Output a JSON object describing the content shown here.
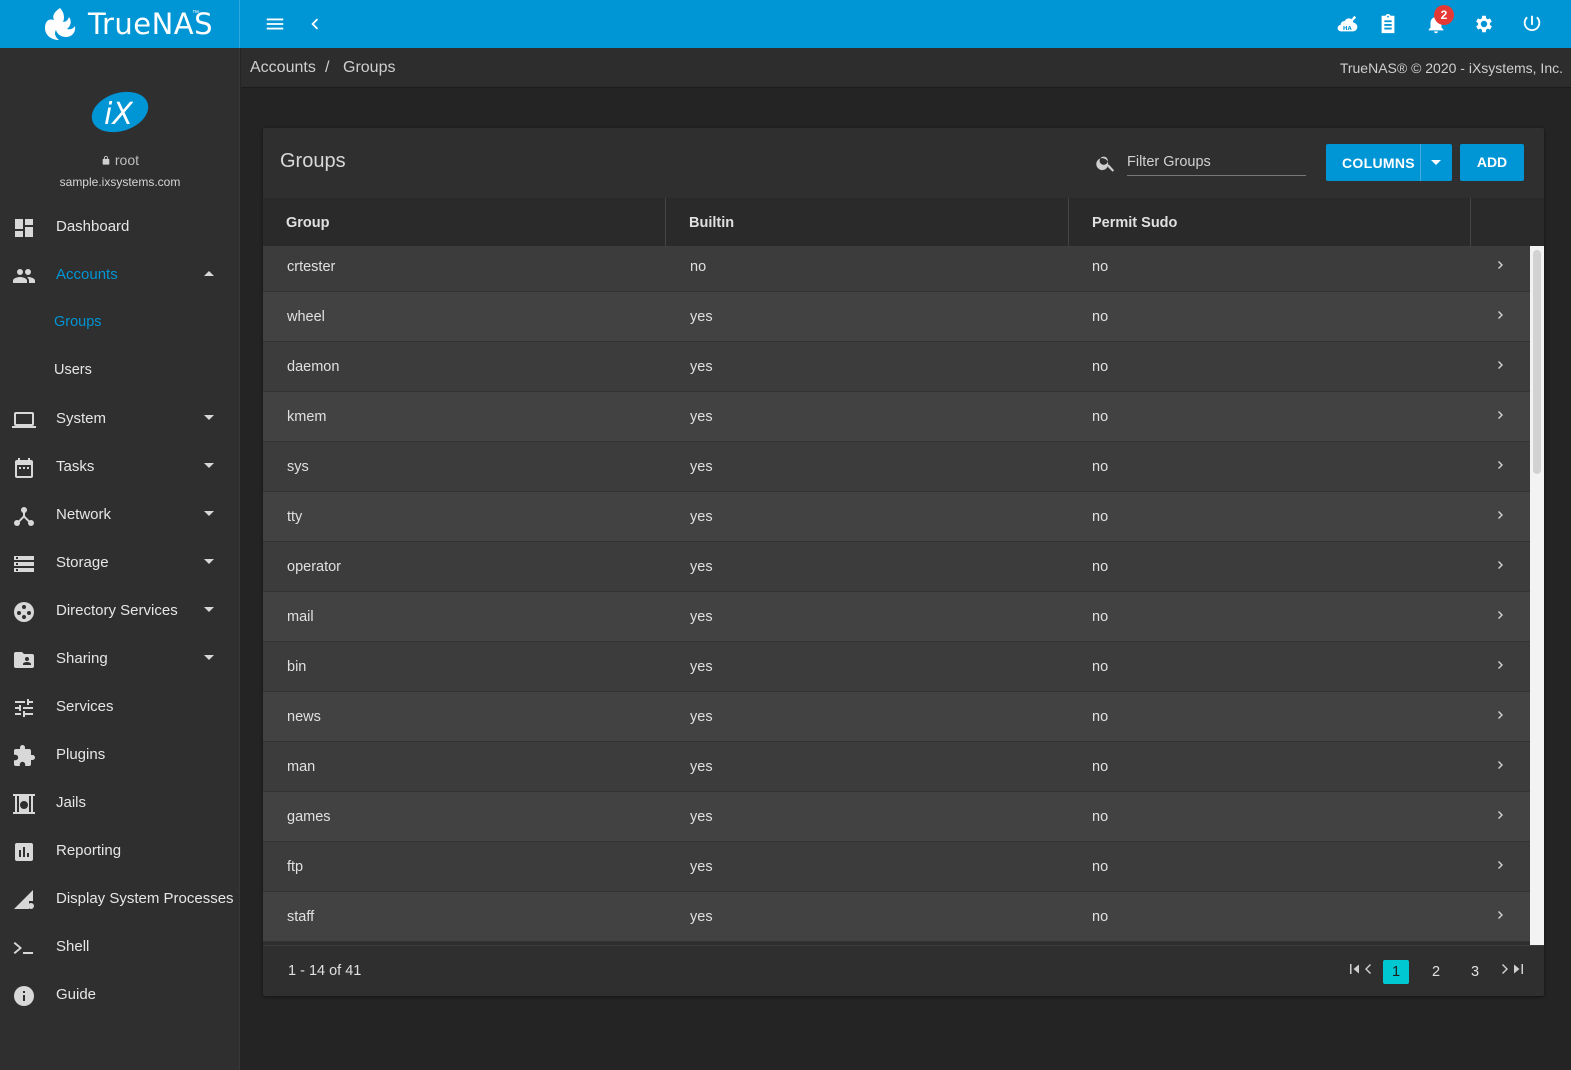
{
  "app": {
    "brand": "TrueNAS",
    "brand_tm": "™"
  },
  "topbar": {
    "menu_icon": "menu-icon",
    "back_icon": "chevron-left-icon",
    "ha_icon": "ha-status-icon",
    "tasks_icon": "clipboard-icon",
    "alerts_icon": "bell-icon",
    "alerts_count": "2",
    "settings_icon": "gear-icon",
    "power_icon": "power-icon"
  },
  "sidebar": {
    "logo": "iX",
    "user": "root",
    "hostname": "sample.ixsystems.com",
    "items": [
      {
        "label": "Dashboard",
        "icon": "dashboard-icon"
      },
      {
        "label": "Accounts",
        "icon": "people-icon"
      },
      {
        "label": "Groups"
      },
      {
        "label": "Users"
      },
      {
        "label": "System",
        "icon": "laptop-icon"
      },
      {
        "label": "Tasks",
        "icon": "calendar-icon"
      },
      {
        "label": "Network",
        "icon": "network-icon"
      },
      {
        "label": "Storage",
        "icon": "storage-icon"
      },
      {
        "label": "Directory Services",
        "icon": "directory-icon"
      },
      {
        "label": "Sharing",
        "icon": "folder-shared-icon"
      },
      {
        "label": "Services",
        "icon": "tune-icon"
      },
      {
        "label": "Plugins",
        "icon": "puzzle-icon"
      },
      {
        "label": "Jails",
        "icon": "jail-icon"
      },
      {
        "label": "Reporting",
        "icon": "bar-chart-icon"
      },
      {
        "label": "Display System Processes",
        "icon": "processes-icon"
      },
      {
        "label": "Shell",
        "icon": "terminal-icon"
      },
      {
        "label": "Guide",
        "icon": "info-icon"
      }
    ]
  },
  "breadcrumb": {
    "parent": "Accounts",
    "separator": "/",
    "current": "Groups"
  },
  "copyright": "TrueNAS® © 2020 - iXsystems, Inc.",
  "card": {
    "title": "Groups",
    "search_placeholder": "Filter Groups",
    "columns_button": "COLUMNS",
    "add_button": "ADD"
  },
  "table": {
    "columns": [
      "Group",
      "Builtin",
      "Permit Sudo"
    ],
    "rows": [
      [
        "crtester",
        "no",
        "no"
      ],
      [
        "wheel",
        "yes",
        "no"
      ],
      [
        "daemon",
        "yes",
        "no"
      ],
      [
        "kmem",
        "yes",
        "no"
      ],
      [
        "sys",
        "yes",
        "no"
      ],
      [
        "tty",
        "yes",
        "no"
      ],
      [
        "operator",
        "yes",
        "no"
      ],
      [
        "mail",
        "yes",
        "no"
      ],
      [
        "bin",
        "yes",
        "no"
      ],
      [
        "news",
        "yes",
        "no"
      ],
      [
        "man",
        "yes",
        "no"
      ],
      [
        "games",
        "yes",
        "no"
      ],
      [
        "ftp",
        "yes",
        "no"
      ],
      [
        "staff",
        "yes",
        "no"
      ]
    ]
  },
  "pagination": {
    "range": "1 - 14 of 41",
    "pages": [
      "1",
      "2",
      "3"
    ],
    "current": "1"
  }
}
